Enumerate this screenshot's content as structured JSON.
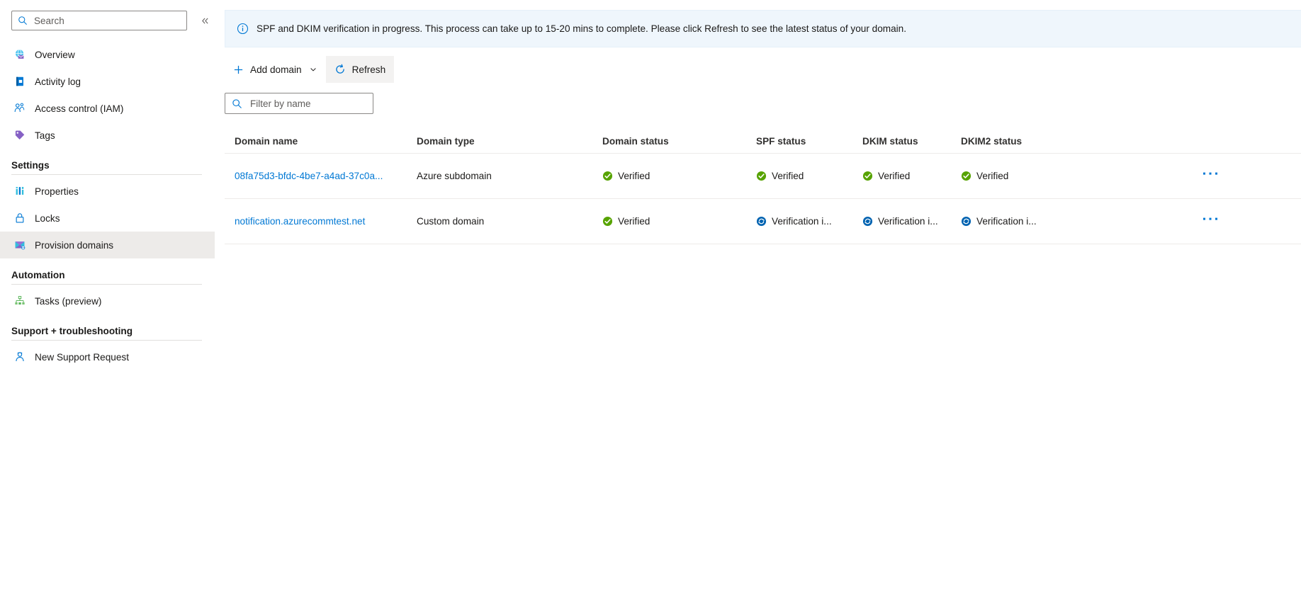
{
  "sidebar": {
    "search": {
      "placeholder": "Search",
      "value": "",
      "icon": "search-icon"
    },
    "collapse": {
      "icon": "chevron-double-left-icon",
      "label": "«"
    },
    "items": [
      {
        "label": "Overview",
        "icon": "overview-globe-icon",
        "active": false
      },
      {
        "label": "Activity log",
        "icon": "activity-log-icon",
        "active": false
      },
      {
        "label": "Access control (IAM)",
        "icon": "access-control-people-icon",
        "active": false
      },
      {
        "label": "Tags",
        "icon": "tags-icon",
        "active": false
      }
    ],
    "groups": [
      {
        "title": "Settings",
        "items": [
          {
            "label": "Properties",
            "icon": "properties-bars-icon",
            "active": false
          },
          {
            "label": "Locks",
            "icon": "lock-icon",
            "active": false
          },
          {
            "label": "Provision domains",
            "icon": "provision-domains-envelope-icon",
            "active": true
          }
        ]
      },
      {
        "title": "Automation",
        "items": [
          {
            "label": "Tasks (preview)",
            "icon": "tasks-hierarchy-icon",
            "active": false
          }
        ]
      },
      {
        "title": "Support + troubleshooting",
        "items": [
          {
            "label": "New Support Request",
            "icon": "support-person-icon",
            "active": false
          }
        ]
      }
    ]
  },
  "banner": {
    "icon": "info-circle-icon",
    "text": "SPF and DKIM verification in progress. This process can take up to 15-20 mins to complete. Please click Refresh to see the latest status of your domain."
  },
  "toolbar": {
    "add_domain_label": "Add domain",
    "add_domain_icon": "plus-icon",
    "add_domain_chevron": "chevron-down-icon",
    "refresh_label": "Refresh",
    "refresh_icon": "refresh-circle-icon"
  },
  "filter": {
    "placeholder": "Filter by name",
    "value": "",
    "icon": "search-icon"
  },
  "table": {
    "columns": [
      "Domain name",
      "Domain type",
      "Domain status",
      "SPF status",
      "DKIM status",
      "DKIM2 status"
    ],
    "row_menu_icon": "ellipsis-horizontal-icon",
    "rows": [
      {
        "name": "08fa75d3-bfdc-4be7-a4ad-37c0a...",
        "type": "Azure subdomain",
        "domain_status": {
          "text": "Verified",
          "icon": "check-circle-green-icon"
        },
        "spf_status": {
          "text": "Verified",
          "icon": "check-circle-green-icon"
        },
        "dkim_status": {
          "text": "Verified",
          "icon": "check-circle-green-icon"
        },
        "dkim2_status": {
          "text": "Verified",
          "icon": "check-circle-green-icon"
        }
      },
      {
        "name": "notification.azurecommtest.net",
        "type": "Custom domain",
        "domain_status": {
          "text": "Verified",
          "icon": "check-circle-green-icon"
        },
        "spf_status": {
          "text": "Verification i...",
          "icon": "sync-in-progress-blue-icon"
        },
        "dkim_status": {
          "text": "Verification i...",
          "icon": "sync-in-progress-blue-icon"
        },
        "dkim2_status": {
          "text": "Verification i...",
          "icon": "sync-in-progress-blue-icon"
        }
      }
    ]
  },
  "colors": {
    "link": "#0078d4",
    "success": "#57a300",
    "in_progress": "#0063b1",
    "banner_bg": "#eff6fc",
    "selected_bg": "#edebe9"
  }
}
